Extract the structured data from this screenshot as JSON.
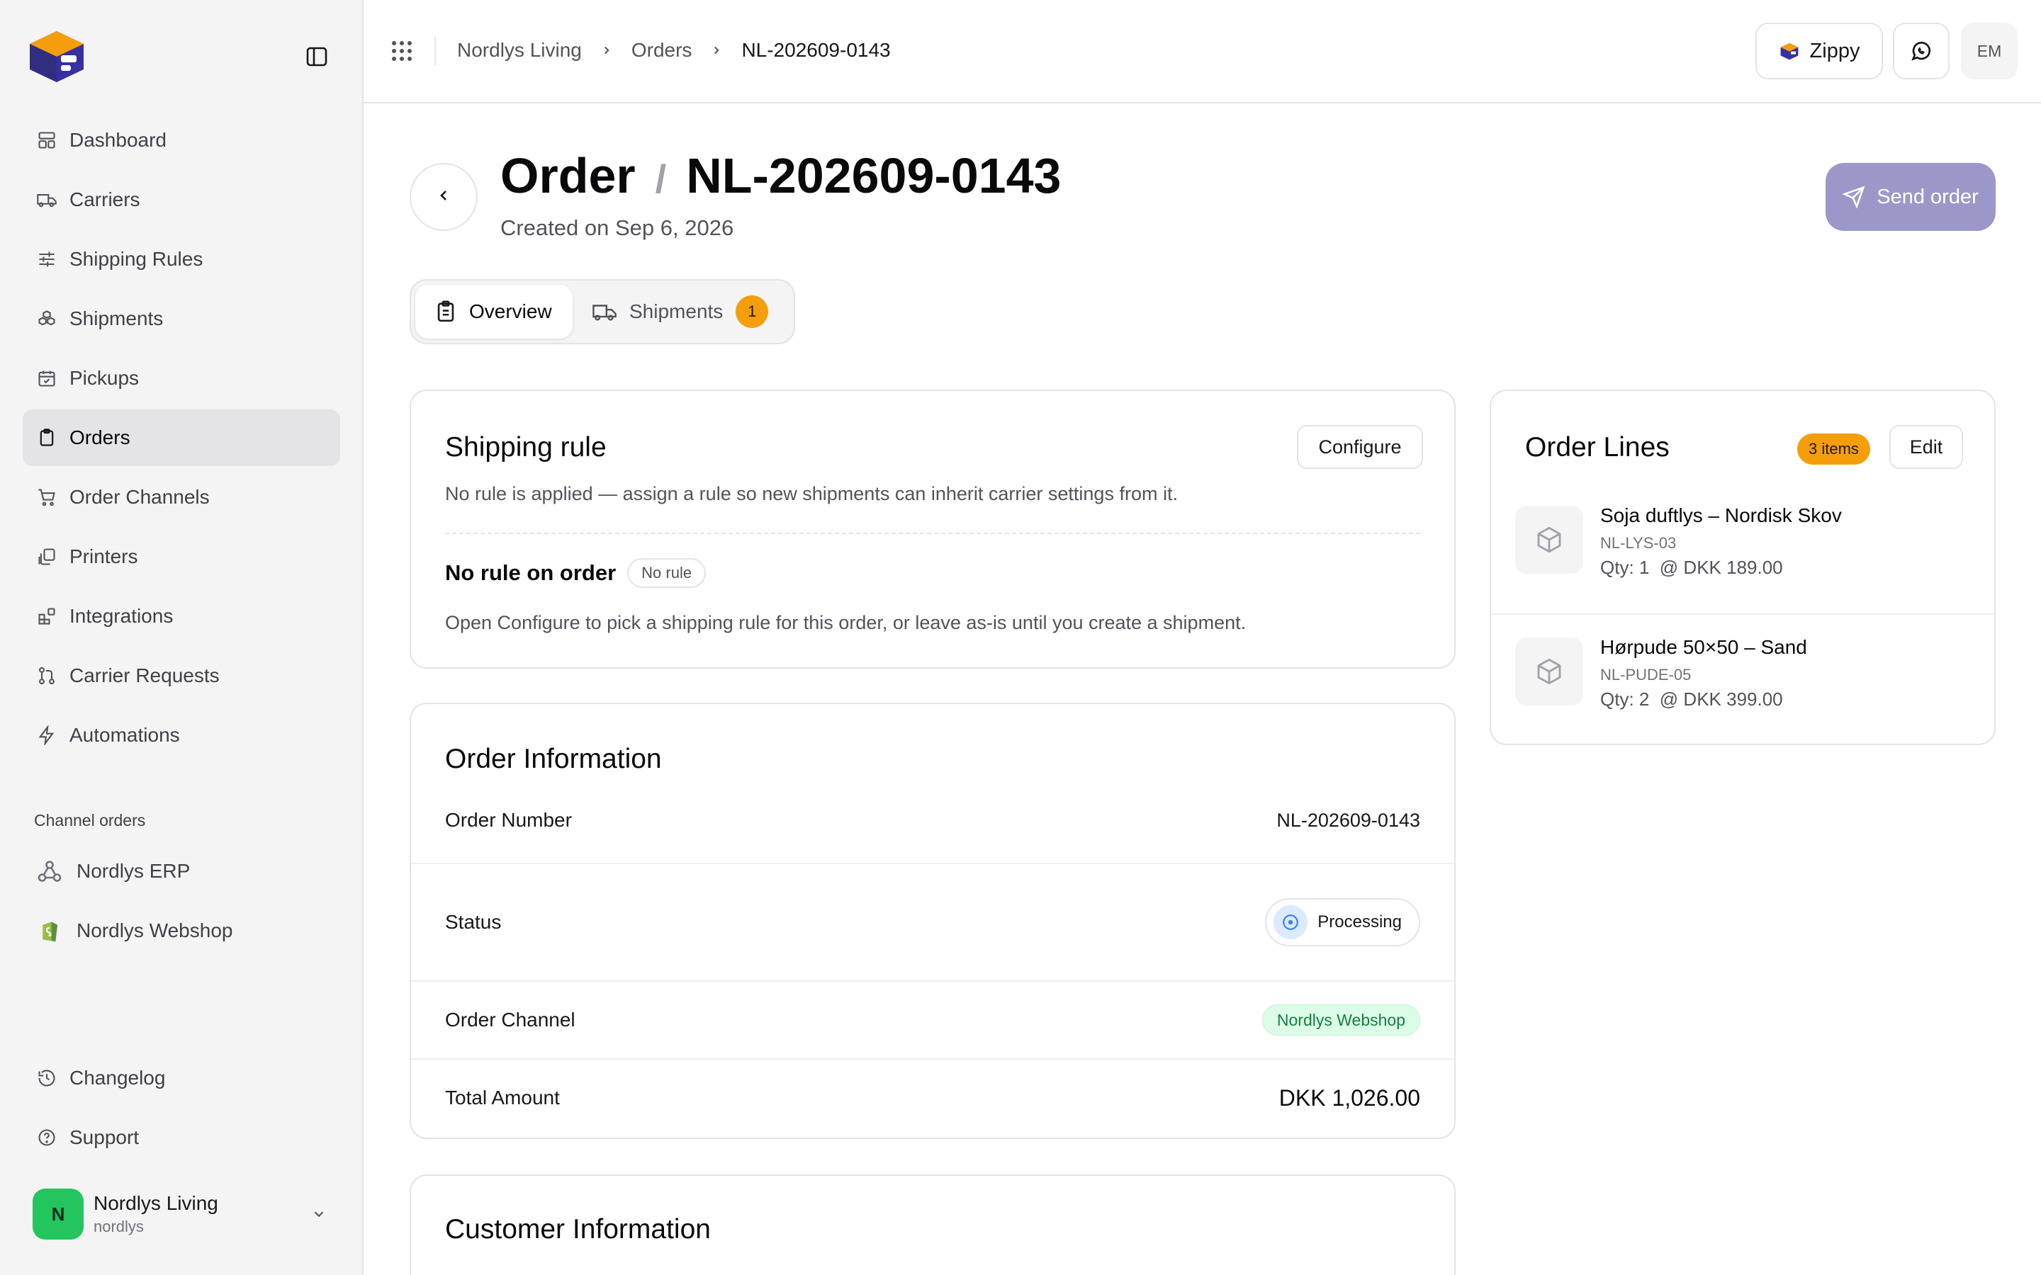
{
  "sidebar": {
    "items": [
      {
        "label": "Dashboard",
        "icon": "layout-dashboard-icon"
      },
      {
        "label": "Carriers",
        "icon": "truck-icon"
      },
      {
        "label": "Shipping Rules",
        "icon": "sliders-icon"
      },
      {
        "label": "Shipments",
        "icon": "boxes-icon"
      },
      {
        "label": "Pickups",
        "icon": "calendar-check-icon"
      },
      {
        "label": "Orders",
        "icon": "clipboard-icon",
        "active": true
      },
      {
        "label": "Order Channels",
        "icon": "cart-icon"
      },
      {
        "label": "Printers",
        "icon": "copy-icon"
      },
      {
        "label": "Integrations",
        "icon": "blocks-icon"
      },
      {
        "label": "Carrier Requests",
        "icon": "git-pull-icon"
      },
      {
        "label": "Automations",
        "icon": "zap-icon"
      }
    ],
    "channel_section_label": "Channel orders",
    "channels": [
      {
        "label": "Nordlys ERP",
        "icon": "webhook-icon"
      },
      {
        "label": "Nordlys Webshop",
        "icon": "shopify-icon"
      }
    ],
    "bottom": [
      {
        "label": "Changelog",
        "icon": "history-icon"
      },
      {
        "label": "Support",
        "icon": "help-circle-icon"
      }
    ],
    "user": {
      "initial": "N",
      "name": "Nordlys Living",
      "handle": "nordlys"
    }
  },
  "topbar": {
    "breadcrumb": [
      "Nordlys Living",
      "Orders",
      "NL-202609-0143"
    ],
    "assistant_label": "Zippy",
    "avatar_initials": "EM"
  },
  "header": {
    "title_prefix": "Order",
    "order_number": "NL-202609-0143",
    "created": "Created on Sep 6, 2026",
    "send_label": "Send order"
  },
  "tabs": [
    {
      "label": "Overview"
    },
    {
      "label": "Shipments",
      "badge": "1"
    }
  ],
  "shipping_rule": {
    "title": "Shipping rule",
    "configure_label": "Configure",
    "description": "No rule is applied — assign a rule so new shipments can inherit carrier settings from it.",
    "status_title": "No rule on order",
    "status_pill": "No rule",
    "hint": "Open Configure to pick a shipping rule for this order, or leave as-is until you create a shipment."
  },
  "order_info": {
    "title": "Order Information",
    "rows": [
      {
        "label": "Order Number",
        "value": "NL-202609-0143"
      },
      {
        "label": "Status",
        "value": "Processing"
      },
      {
        "label": "Order Channel",
        "value": "Nordlys Webshop"
      },
      {
        "label": "Total Amount",
        "value": "DKK 1,026.00"
      }
    ]
  },
  "customer_info": {
    "title": "Customer Information"
  },
  "order_lines": {
    "title": "Order Lines",
    "count_badge": "3 items",
    "edit_label": "Edit",
    "items": [
      {
        "name": "Soja duftlys – Nordisk Skov",
        "sku": "NL-LYS-03",
        "qty": "Qty: 1  @ DKK 189.00"
      },
      {
        "name": "Hørpude 50×50 – Sand",
        "sku": "NL-PUDE-05",
        "qty": "Qty: 2  @ DKK 399.00"
      }
    ]
  },
  "colors": {
    "accent_disabled": "#9b98c9",
    "badge_orange": "#f59e0b",
    "success_green": "#22c55e"
  }
}
